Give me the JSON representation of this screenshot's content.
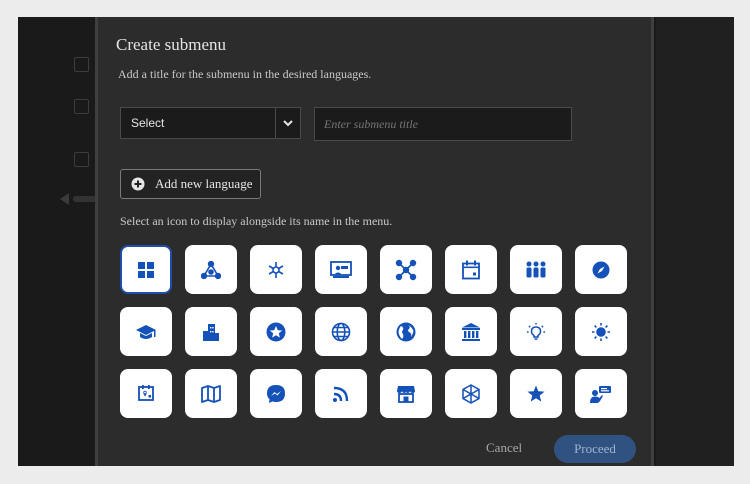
{
  "dialog": {
    "title": "Create submenu",
    "subtitle": "Add a title for the submenu in the desired languages.",
    "language_select": {
      "value": "Select"
    },
    "title_input": {
      "placeholder": "Enter submenu title",
      "value": ""
    },
    "add_language_label": "Add new language",
    "icon_hint": "Select an icon to display alongside its name in the menu.",
    "icons": [
      [
        "grid-icon",
        "network-triangle-icon",
        "hub-icon",
        "presentation-icon",
        "connections-icon",
        "calendar-icon",
        "people-icon",
        "compass-icon"
      ],
      [
        "graduation-cap-icon",
        "buildings-icon",
        "star-badge-icon",
        "globe-icon",
        "earth-icon",
        "bank-icon",
        "lightbulb-icon",
        "sun-icon"
      ],
      [
        "location-calendar-icon",
        "map-icon",
        "messenger-icon",
        "rss-icon",
        "store-icon",
        "cube-network-icon",
        "star-icon",
        "presenter-icon"
      ]
    ],
    "selected_icon": "grid-icon",
    "cancel_label": "Cancel",
    "proceed_label": "Proceed"
  },
  "colors": {
    "icon": "#1451b8",
    "proceed_bg": "#2f5281",
    "dialog_bg": "#2c2c2c"
  }
}
